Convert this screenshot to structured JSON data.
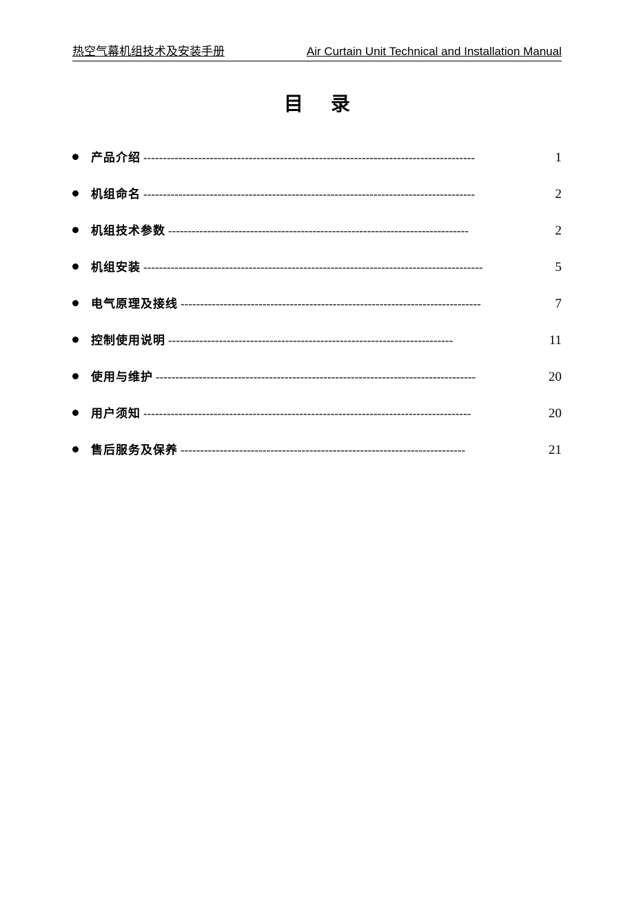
{
  "header": {
    "left": "热空气幕机组技术及安装手册",
    "right": "Air Curtain Unit Technical and Installation Manual"
  },
  "title": "目录",
  "toc": [
    {
      "label": "产品介绍 ",
      "page": "1"
    },
    {
      "label": "机组命名 ",
      "page": "2"
    },
    {
      "label": "机组技术参数 ",
      "page": "2"
    },
    {
      "label": "机组安装",
      "page": "5"
    },
    {
      "label": "电气原理及接线",
      "page": "7"
    },
    {
      "label": "控制使用说明",
      "page": "11"
    },
    {
      "label": "使用与维护 ",
      "page": "20"
    },
    {
      "label": "用户须知 ",
      "page": "20"
    },
    {
      "label": "售后服务及保养",
      "page": "21"
    }
  ]
}
